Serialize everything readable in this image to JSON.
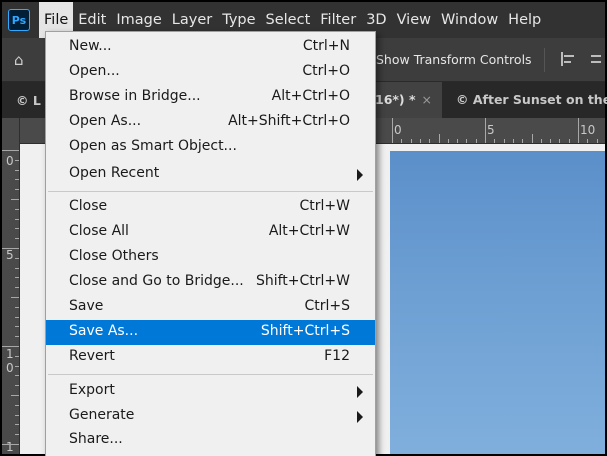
{
  "menubar": {
    "logo": "Ps",
    "items": [
      "File",
      "Edit",
      "Image",
      "Layer",
      "Type",
      "Select",
      "Filter",
      "3D",
      "View",
      "Window",
      "Help"
    ]
  },
  "options": {
    "show_transform_label": "Show Transform Controls"
  },
  "tabs": {
    "left_label": "© L",
    "active_label": "16*) *",
    "active_close": "×",
    "other_label": "© After Sunset on the"
  },
  "rulers": {
    "top_numbers": [
      "0",
      "5",
      "10"
    ],
    "left_numbers": [
      "0",
      "5",
      "1",
      "0",
      "1"
    ]
  },
  "file_menu": {
    "items": [
      {
        "label": "New...",
        "shortcut": "Ctrl+N"
      },
      {
        "label": "Open...",
        "shortcut": "Ctrl+O"
      },
      {
        "label": "Browse in Bridge...",
        "shortcut": "Alt+Ctrl+O"
      },
      {
        "label": "Open As...",
        "shortcut": "Alt+Shift+Ctrl+O"
      },
      {
        "label": "Open as Smart Object...",
        "shortcut": ""
      },
      {
        "label": "Open Recent",
        "shortcut": ""
      },
      {
        "label": "Close",
        "shortcut": "Ctrl+W"
      },
      {
        "label": "Close All",
        "shortcut": "Alt+Ctrl+W"
      },
      {
        "label": "Close Others",
        "shortcut": ""
      },
      {
        "label": "Close and Go to Bridge...",
        "shortcut": "Shift+Ctrl+W"
      },
      {
        "label": "Save",
        "shortcut": "Ctrl+S"
      },
      {
        "label": "Save As...",
        "shortcut": "Shift+Ctrl+S"
      },
      {
        "label": "Revert",
        "shortcut": "F12"
      },
      {
        "label": "Export",
        "shortcut": ""
      },
      {
        "label": "Generate",
        "shortcut": ""
      },
      {
        "label": "Share...",
        "shortcut": ""
      }
    ]
  },
  "colors": {
    "highlight": "#0078d7",
    "menubar_bg": "#323232",
    "menu_bg": "#f0f0f0"
  }
}
